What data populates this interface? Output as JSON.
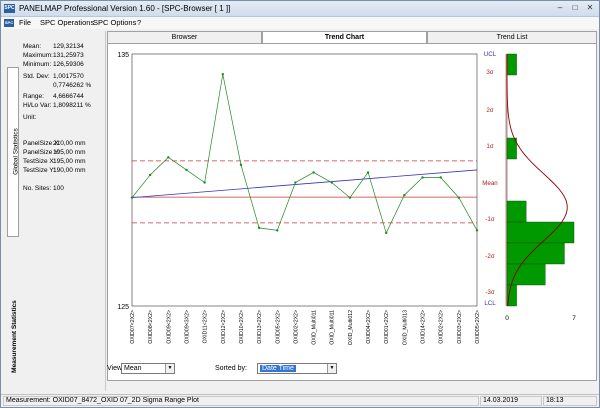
{
  "window": {
    "app_icon": "SPC",
    "title": "PANELMAP   Professional Version 1.60 - [SPC-Browser [ 1 ]]",
    "min_icon": "minimize-icon",
    "max_icon": "maximize-icon",
    "close_icon": "close-icon"
  },
  "menu": {
    "icon": "SPC",
    "items": [
      "File",
      "SPC Operations",
      "SPC Options",
      "?"
    ]
  },
  "left_panel": {
    "global_tab": "Global Statistics",
    "measurement_tab": "Measurement Statistics",
    "stats": [
      {
        "label": "Mean:",
        "value": "129,32134"
      },
      {
        "label": "Maximum:",
        "value": "131,25973"
      },
      {
        "label": "Minimum:",
        "value": "126,59306"
      },
      {
        "label": "Std. Dev:",
        "value": "1,0017570"
      },
      {
        "label": "",
        "value": "0,7746262 %"
      },
      {
        "label": "Range:",
        "value": "4,6666744"
      },
      {
        "label": "Hi/Lo Var:",
        "value": "1,8098211 %"
      },
      {
        "label": "Unit:",
        "value": ""
      },
      {
        "label": "PanelSize X:",
        "value": "210,00 mm"
      },
      {
        "label": "PanelSize Y:",
        "value": "195,00 mm"
      },
      {
        "label": "TestSize X:",
        "value": "195,00 mm"
      },
      {
        "label": "TestSize Y:",
        "value": "190,00 mm"
      },
      {
        "label": "No. Sites:",
        "value": "100"
      }
    ]
  },
  "tabs": [
    "Browser",
    "Trend Chart",
    "Trend List"
  ],
  "active_tab": "Trend Chart",
  "controls": {
    "view_label": "View:",
    "view_value": "Mean",
    "sorted_label": "Sorted by:",
    "sorted_value": "Date Time"
  },
  "status": {
    "measurement": "Measurement: OXID07_8472_OXID 07_2D Sigma Range Plot",
    "date": "14.03.2019",
    "time": "18:13"
  },
  "colors": {
    "data_line": "#228822",
    "trend_line": "#3333bb",
    "mean_line": "#cc3333",
    "sigma_line": "#cc3333",
    "histogram": "#009900",
    "normal_curve": "#880000",
    "axis_label": "#aa2222"
  },
  "chart_data": [
    {
      "type": "line",
      "ylim": [
        125,
        135
      ],
      "y_tick_labels": [
        "135",
        "125"
      ],
      "categories": [
        "OXID07<2X2>",
        "OXID08<2X2>",
        "OXID09<2X2>",
        "OXID09<3X2>",
        "OXID11<2X2>",
        "OXID12<2X2>",
        "OXID10<2X2>",
        "OXID13<2X2>",
        "OXID05<2X2>",
        "OXID02<2X2>",
        "OXID_Multi011",
        "OXID_Multi011",
        "OXID_Multi012",
        "OXID04<2X2>",
        "OXID01<2X2>",
        "OXID_Multi013",
        "OXID14<2X2>",
        "OXID02<2X2>",
        "OXID03<2X2>",
        "OXID05<2X2>"
      ],
      "values": [
        129.3,
        130.2,
        130.9,
        130.4,
        129.9,
        134.2,
        130.6,
        128.1,
        128.0,
        129.9,
        130.3,
        129.9,
        129.3,
        130.3,
        127.9,
        129.4,
        130.1,
        130.1,
        129.3,
        128.0
      ],
      "mean": 129.32,
      "sigma_lines": [
        130.76,
        128.3
      ],
      "right_axis_labels": [
        "UCL",
        "3σ",
        "2σ",
        "1σ",
        "Mean",
        "-1σ",
        "-2σ",
        "-3σ",
        "LCL"
      ],
      "trend_line": [
        129.3,
        130.4
      ]
    },
    {
      "type": "bar",
      "orientation": "horizontal",
      "xlim": [
        0,
        7
      ],
      "x_tick_labels": [
        "0",
        "7"
      ],
      "bins": [
        1,
        0,
        0,
        0,
        1,
        0,
        0,
        2,
        7,
        6,
        4,
        1
      ]
    }
  ]
}
